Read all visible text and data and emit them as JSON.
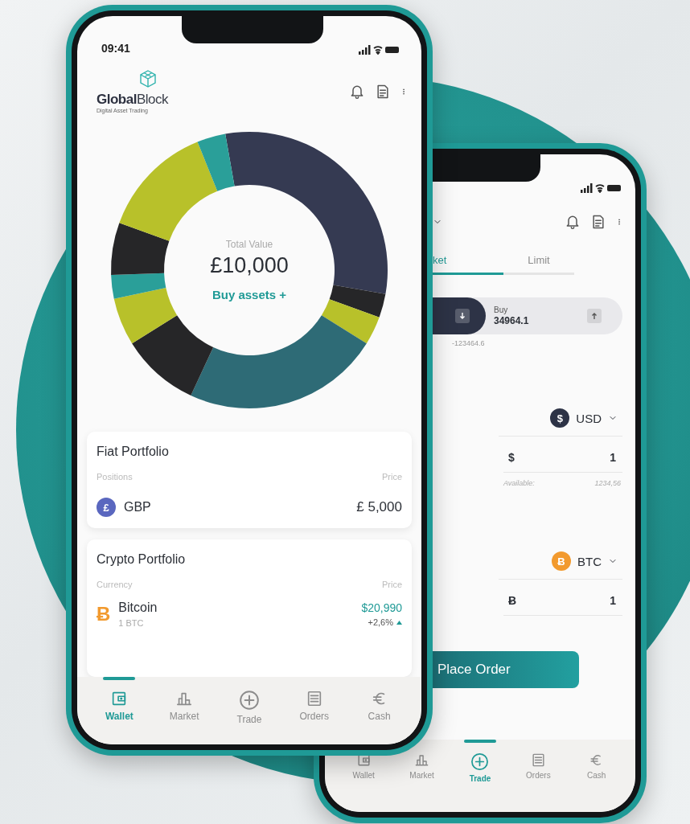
{
  "phones": [
    {
      "kind": "portfolio",
      "status_time": "09:41",
      "brand": {
        "name": "**Global**Block",
        "tagline": "Digital Asset Trading"
      },
      "summary": {
        "label": "Total Value",
        "value": "£10,000",
        "action": "Buy assets +"
      },
      "sections": [
        {
          "title": "Fiat Portfolio",
          "column_1": "Positions",
          "column_2": "Price",
          "rows": [
            {
              "kind": "fiat",
              "badge": "£",
              "color": "#5a67bf",
              "name": "GBP",
              "price": "£ 5,000"
            }
          ]
        },
        {
          "title": "Crypto Portfolio",
          "column_1": "Currency",
          "column_2": "Price",
          "rows": [
            {
              "kind": "crypto",
              "badge": "Ƀ",
              "color": "#f29a2e",
              "name": "Bitcoin",
              "amount": "1 BTC",
              "price": "$20,990",
              "change": "+2,6%"
            }
          ]
        }
      ],
      "nav": [
        {
          "kind": "wallet",
          "label": "Wallet",
          "selected": true
        },
        {
          "kind": "market",
          "label": "Market",
          "selected": false
        },
        {
          "kind": "trade",
          "label": "Trade",
          "selected": false
        },
        {
          "kind": "orders",
          "label": "Orders",
          "selected": false
        },
        {
          "kind": "cash",
          "label": "Cash",
          "selected": false
        }
      ]
    },
    {
      "kind": "trade",
      "tabs": [
        {
          "label": "ket",
          "selected": true
        },
        {
          "label": "Limit",
          "selected": false
        }
      ],
      "sell": {
        "value": "-123464.6"
      },
      "buy": {
        "label": "Buy",
        "value": "34964.1"
      },
      "assets": [
        {
          "badge": "$",
          "color": "#2d3346",
          "currency": "USD",
          "symbol": "$",
          "amount": "1",
          "available_label": "Available:",
          "available": "1234,56"
        },
        {
          "badge": "Ƀ",
          "color": "#f29a2e",
          "currency": "BTC",
          "symbol": "Ƀ",
          "amount": "1"
        }
      ],
      "action": "Place Order",
      "nav": [
        {
          "kind": "wallet",
          "label": "Wallet",
          "selected": false
        },
        {
          "kind": "market",
          "label": "Market",
          "selected": false
        },
        {
          "kind": "trade",
          "label": "Trade",
          "selected": true
        },
        {
          "kind": "orders",
          "label": "Orders",
          "selected": false
        },
        {
          "kind": "cash",
          "label": "Cash",
          "selected": false
        }
      ]
    }
  ]
}
